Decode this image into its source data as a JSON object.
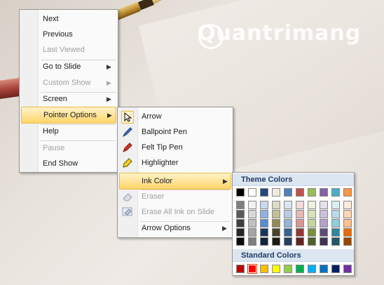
{
  "watermark": "Quantrimang",
  "menu1": {
    "next": "Next",
    "previous": "Previous",
    "last_viewed": "Last Viewed",
    "go_to_slide": "Go to Slide",
    "custom_show": "Custom Show",
    "screen": "Screen",
    "pointer_options": "Pointer Options",
    "help": "Help",
    "pause": "Pause",
    "end_show": "End Show"
  },
  "menu2": {
    "arrow": "Arrow",
    "ballpoint_pen": "Ballpoint Pen",
    "felt_tip_pen": "Felt Tip Pen",
    "highlighter": "Highlighter",
    "ink_color": "Ink Color",
    "eraser": "Eraser",
    "erase_all": "Erase All Ink on Slide",
    "arrow_options": "Arrow Options"
  },
  "palette": {
    "theme_title": "Theme Colors",
    "standard_title": "Standard Colors",
    "theme_top": [
      "#000000",
      "#ffffff",
      "#1f497d",
      "#eeece1",
      "#4f81bd",
      "#c0504d",
      "#9bbb59",
      "#8064a2",
      "#4bacc6",
      "#f79646"
    ],
    "theme_shades": [
      [
        "#7f7f7f",
        "#595959",
        "#3f3f3f",
        "#262626",
        "#0c0c0c"
      ],
      [
        "#f2f2f2",
        "#d8d8d8",
        "#bfbfbf",
        "#a5a5a5",
        "#7f7f7f"
      ],
      [
        "#c6d9f0",
        "#8db3e2",
        "#548dd4",
        "#17365d",
        "#0f243e"
      ],
      [
        "#ddd9c3",
        "#c4bd97",
        "#938953",
        "#494429",
        "#1d1b10"
      ],
      [
        "#dbe5f1",
        "#b8cce4",
        "#95b3d7",
        "#366092",
        "#244061"
      ],
      [
        "#f2dcdb",
        "#e5b9b7",
        "#d99694",
        "#953734",
        "#632423"
      ],
      [
        "#ebf1dd",
        "#d7e3bc",
        "#c3d69b",
        "#76923c",
        "#4f6128"
      ],
      [
        "#e5e0ec",
        "#ccc1d9",
        "#b2a2c7",
        "#5f497a",
        "#3f3151"
      ],
      [
        "#dbeef3",
        "#b7dde8",
        "#92cddc",
        "#31859b",
        "#205867"
      ],
      [
        "#fdeada",
        "#fbd5b5",
        "#fac08f",
        "#e36c09",
        "#974806"
      ]
    ],
    "standard": [
      "#c00000",
      "#ff0000",
      "#ffc000",
      "#ffff00",
      "#92d050",
      "#00b050",
      "#00b0f0",
      "#0070c0",
      "#002060",
      "#7030a0"
    ],
    "selected_standard_index": 1
  }
}
